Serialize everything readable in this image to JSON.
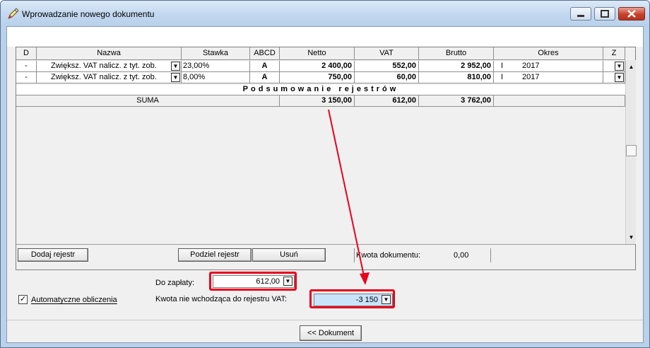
{
  "window": {
    "title": "Wprowadzanie nowego dokumentu"
  },
  "grid": {
    "headers": {
      "d": "D",
      "nazwa": "Nazwa",
      "stawka": "Stawka",
      "abcd": "ABCD",
      "netto": "Netto",
      "vat": "VAT",
      "brutto": "Brutto",
      "okres": "Okres",
      "z": "Z"
    },
    "rows": [
      {
        "d": "-",
        "nazwa": "Zwiększ. VAT nalicz. z tyt. zob.",
        "stawka": "23,00%",
        "abcd": "A",
        "netto": "2 400,00",
        "vat": "552,00",
        "brutto": "2 952,00",
        "okres_month": "I",
        "okres_year": "2017"
      },
      {
        "d": "-",
        "nazwa": "Zwiększ. VAT nalicz. z tyt. zob.",
        "stawka": "8,00%",
        "abcd": "A",
        "netto": "750,00",
        "vat": "60,00",
        "brutto": "810,00",
        "okres_month": "I",
        "okres_year": "2017"
      }
    ],
    "summary_title": "Podsumowanie rejestrów",
    "summary": {
      "label": "SUMA",
      "netto": "3 150,00",
      "vat": "612,00",
      "brutto": "3 762,00"
    }
  },
  "buttons": {
    "dodaj": "Dodaj rejestr",
    "podziel": "Podziel rejestr",
    "usun": "Usuń",
    "dokument": "<< Dokument"
  },
  "kwota_dokumentu": {
    "label": "Kwota dokumentu:",
    "value": "0,00"
  },
  "do_zaplaty": {
    "label": "Do zapłaty:",
    "value": "612,00"
  },
  "kwota_nie_wchodzaca": {
    "label": "Kwota nie wchodząca do rejestru VAT:",
    "value": "-3 150"
  },
  "auto": {
    "label": "Automatyczne obliczenia",
    "checked": true
  },
  "colors": {
    "highlight": "#e8001c",
    "selected_field": "#c9e3fb"
  }
}
